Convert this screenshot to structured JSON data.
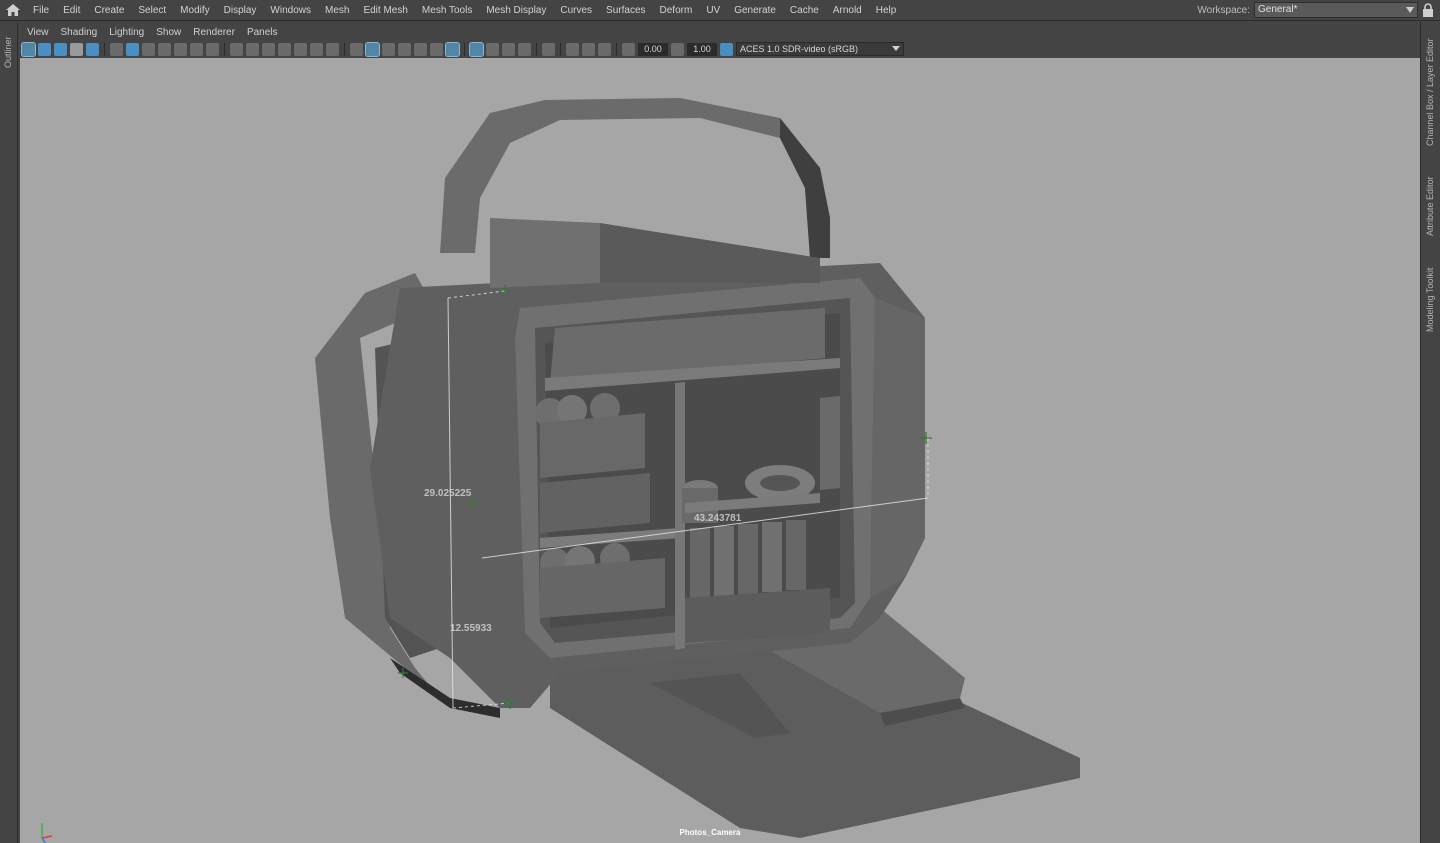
{
  "menubar": {
    "items": [
      "File",
      "Edit",
      "Create",
      "Select",
      "Modify",
      "Display",
      "Windows",
      "Mesh",
      "Edit Mesh",
      "Mesh Tools",
      "Mesh Display",
      "Curves",
      "Surfaces",
      "Deform",
      "UV",
      "Generate",
      "Cache",
      "Arnold",
      "Help"
    ],
    "workspace_label": "Workspace:",
    "workspace_value": "General*"
  },
  "left_tabs": {
    "outliner": "Outliner"
  },
  "right_tabs": {
    "channel_box": "Channel Box / Layer Editor",
    "attribute_editor": "Attribute Editor",
    "modeling_toolkit": "Modeling Toolkit"
  },
  "panel": {
    "menu": [
      "View",
      "Shading",
      "Lighting",
      "Show",
      "Renderer",
      "Panels"
    ],
    "exposure": "0.00",
    "gamma": "1.00",
    "color_space": "ACES 1.0 SDR-video (sRGB)"
  },
  "viewport": {
    "camera": "Photos_Camera",
    "measure_height": "29.025225",
    "measure_width": "43.243781",
    "measure_depth": "12.55933",
    "background": "#a6a6a6"
  },
  "colors": {
    "accent": "#4a8fc3",
    "mesh": "#5e5e5e"
  }
}
